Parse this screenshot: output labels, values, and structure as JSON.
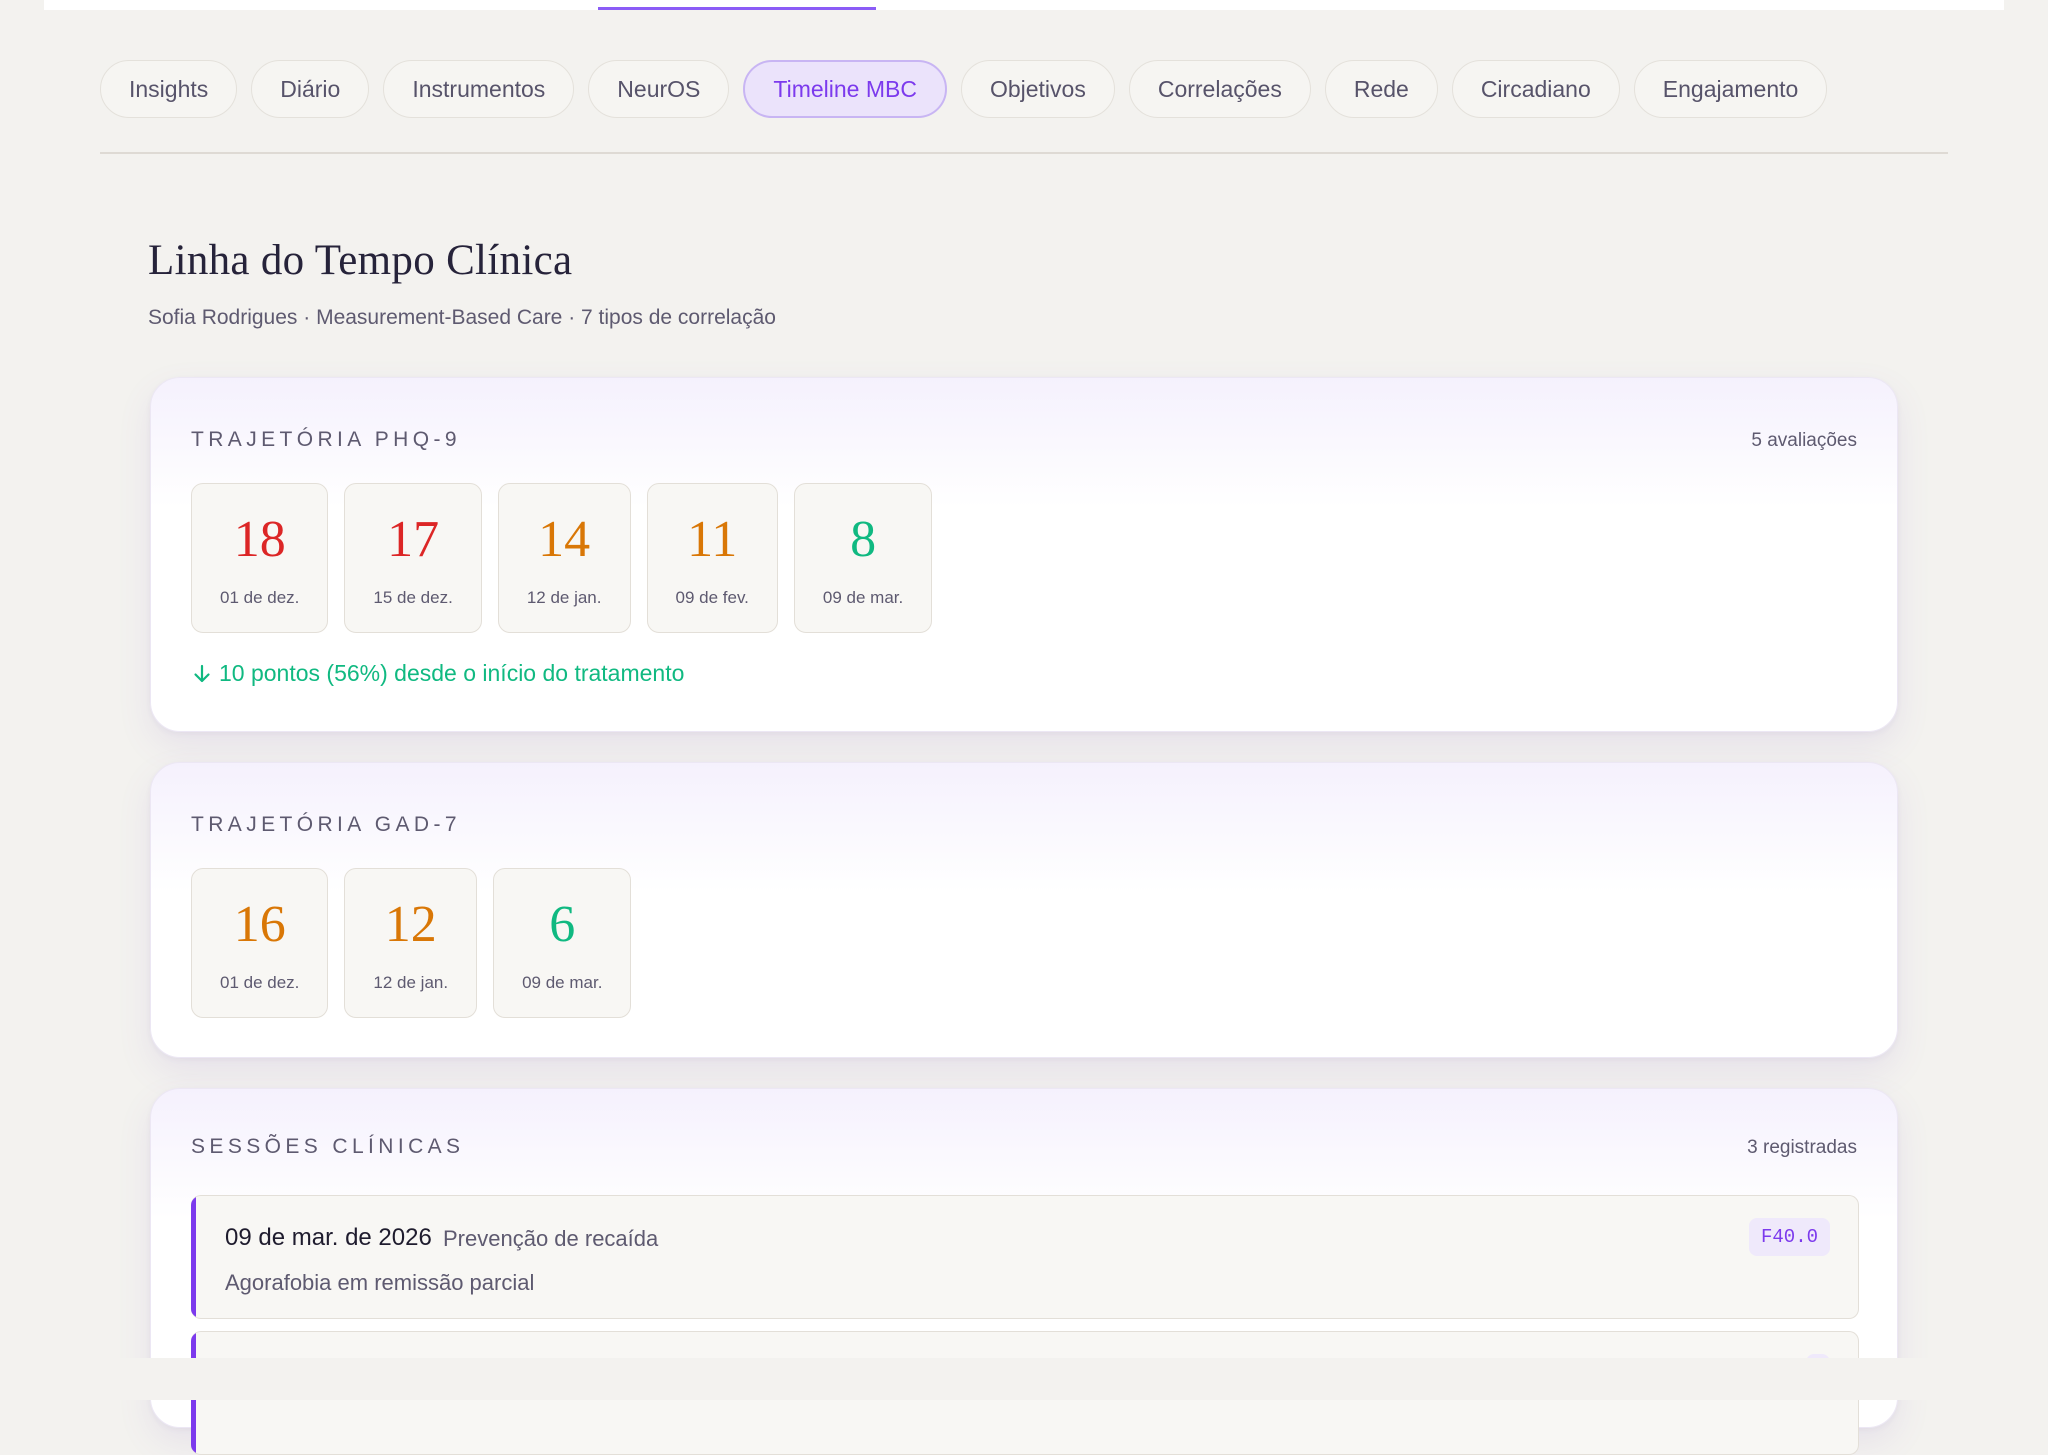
{
  "colors": {
    "accent": "#7c3aed",
    "severe": "#dc2626",
    "moderate": "#d97706",
    "mild": "#10b981"
  },
  "tabs": [
    {
      "label": "Insights",
      "active": false
    },
    {
      "label": "Diário",
      "active": false
    },
    {
      "label": "Instrumentos",
      "active": false
    },
    {
      "label": "NeurOS",
      "active": false
    },
    {
      "label": "Timeline MBC",
      "active": true
    },
    {
      "label": "Objetivos",
      "active": false
    },
    {
      "label": "Correlações",
      "active": false
    },
    {
      "label": "Rede",
      "active": false
    },
    {
      "label": "Circadiano",
      "active": false
    },
    {
      "label": "Engajamento",
      "active": false
    }
  ],
  "page": {
    "title": "Linha do Tempo Clínica",
    "subtitle": "Sofia Rodrigues · Measurement-Based Care · 7 tipos de correlação"
  },
  "phq9": {
    "title": "TRAJETÓRIA PHQ-9",
    "meta": "5 avaliações",
    "scores": [
      {
        "value": "18",
        "date": "01 de dez.",
        "color": "#dc2626"
      },
      {
        "value": "17",
        "date": "15 de dez.",
        "color": "#dc2626"
      },
      {
        "value": "14",
        "date": "12 de jan.",
        "color": "#d97706"
      },
      {
        "value": "11",
        "date": "09 de fev.",
        "color": "#d97706"
      },
      {
        "value": "8",
        "date": "09 de mar.",
        "color": "#10b981"
      }
    ],
    "summary": "10 pontos (56%) desde o início do tratamento",
    "summary_icon": "arrow-down-icon"
  },
  "gad7": {
    "title": "TRAJETÓRIA GAD-7",
    "scores": [
      {
        "value": "16",
        "date": "01 de dez.",
        "color": "#d97706"
      },
      {
        "value": "12",
        "date": "12 de jan.",
        "color": "#d97706"
      },
      {
        "value": "6",
        "date": "09 de mar.",
        "color": "#10b981"
      }
    ]
  },
  "sessions": {
    "title": "SESSÕES CLÍNICAS",
    "meta": "3 registradas",
    "items": [
      {
        "date": "09 de mar. de 2026",
        "type": "Prevenção de recaída",
        "note": "Agorafobia em remissão parcial",
        "code": "F40.0"
      },
      {
        "date": "",
        "type": "",
        "note": "",
        "code": ""
      }
    ]
  }
}
